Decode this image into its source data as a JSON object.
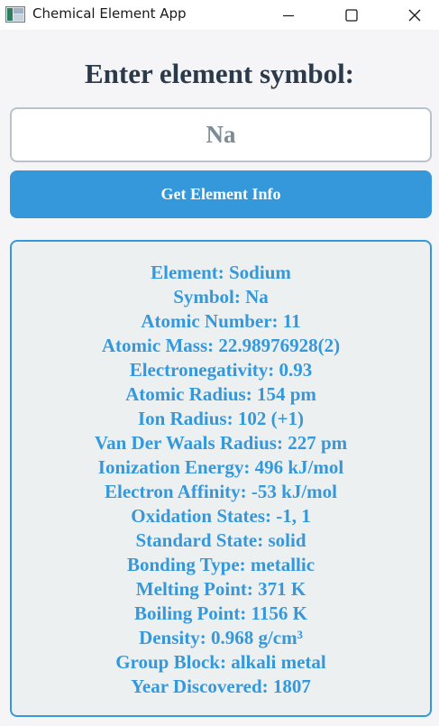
{
  "window": {
    "title": "Chemical Element App",
    "icon": "app-icon",
    "controls": [
      "minimize-icon",
      "maximize-icon",
      "close-icon"
    ]
  },
  "prompt": "Enter element symbol:",
  "symbol_input": {
    "value": "Na"
  },
  "button": {
    "label": "Get Element Info"
  },
  "info": {
    "lines": [
      "Element: Sodium",
      "Symbol: Na",
      "Atomic Number: 11",
      "Atomic Mass: 22.98976928(2)",
      "Electronegativity: 0.93",
      "Atomic Radius: 154 pm",
      "Ion Radius: 102 (+1)",
      "Van Der Waals Radius: 227 pm",
      "Ionization Energy: 496 kJ/mol",
      "Electron Affinity: -53 kJ/mol",
      "Oxidation States: -1, 1",
      "Standard State: solid",
      "Bonding Type: metallic",
      "Melting Point: 371 K",
      "Boiling Point: 1156 K",
      "Density: 0.968 g/cm³",
      "Group Block: alkali metal",
      "Year Discovered: 1807"
    ]
  },
  "colors": {
    "accent": "#3498db",
    "heading": "#2b3a4a",
    "panel_bg": "#ecf0f1",
    "input_text": "#7d8b95"
  }
}
